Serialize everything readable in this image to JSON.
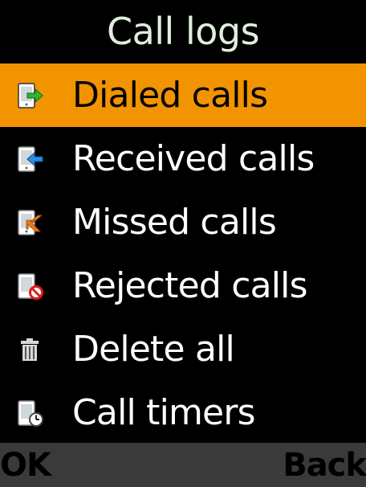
{
  "title": "Call logs",
  "menu": {
    "items": [
      {
        "label": "Dialed calls",
        "icon": "dialed-call-icon",
        "selected": true
      },
      {
        "label": "Received calls",
        "icon": "received-call-icon",
        "selected": false
      },
      {
        "label": "Missed calls",
        "icon": "missed-call-icon",
        "selected": false
      },
      {
        "label": "Rejected calls",
        "icon": "rejected-call-icon",
        "selected": false
      },
      {
        "label": "Delete all",
        "icon": "trash-icon",
        "selected": false
      },
      {
        "label": "Call timers",
        "icon": "call-timer-icon",
        "selected": false
      }
    ]
  },
  "softkeys": {
    "left": "OK",
    "right": "Back"
  },
  "colors": {
    "background": "#000000",
    "selection": "#f29400",
    "softkey_bar": "#3a3a3a",
    "title_text": "#dfeedd"
  }
}
